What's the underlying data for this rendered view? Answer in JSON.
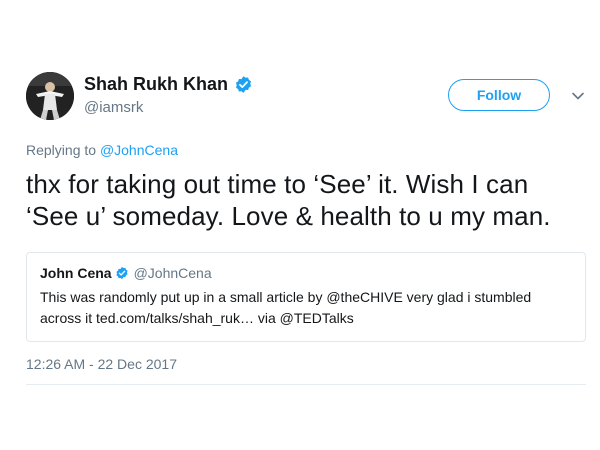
{
  "author": {
    "display_name": "Shah Rukh Khan",
    "handle": "@iamsrk",
    "verified_icon": "verified-badge-icon"
  },
  "follow_label": "Follow",
  "menu_icon": "chevron-down-icon",
  "reply": {
    "prefix": "Replying to",
    "mention": "@JohnCena"
  },
  "tweet": {
    "text": "thx for taking out time to ‘See’ it. Wish I can ‘See u’ someday. Love & health to u my man."
  },
  "quoted_tweet": {
    "display_name": "John Cena",
    "handle": "@JohnCena",
    "text": "This was randomly put up in a small article by @theCHIVE very glad i stumbled across it ted.com/talks/shah_ruk… via @TEDTalks"
  },
  "timestamp": "12:26 AM - 22 Dec 2017",
  "colors": {
    "accent": "#1da1f2",
    "secondary_text": "#657786",
    "primary_text": "#14171a",
    "border": "#e1e8ed"
  }
}
